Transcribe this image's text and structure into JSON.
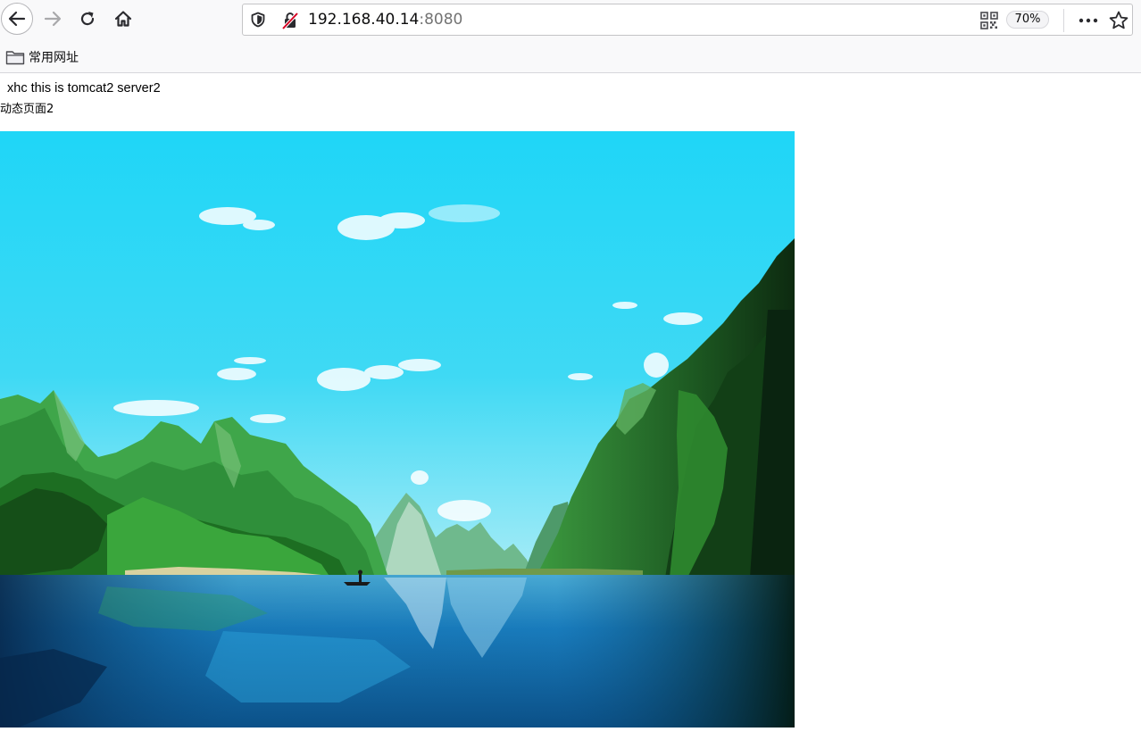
{
  "browser": {
    "url_host": "192.168.40.14",
    "url_port": ":8080",
    "zoom": "70%",
    "icons": {
      "back": "arrow-left-icon",
      "forward": "arrow-right-icon",
      "reload": "reload-icon",
      "home": "home-icon",
      "tracking": "shield-icon",
      "insecure": "insecure-connection-icon",
      "qr": "qr-code-icon",
      "menu": "more-dots-icon",
      "bookmark": "star-icon"
    }
  },
  "bookmarks_bar": {
    "folder_label": "常用网址",
    "folder_icon": "folder-icon"
  },
  "page": {
    "heading": "xhc this is tomcat2 server2",
    "subheading": "动态页面2"
  },
  "colors": {
    "sky": "#1fd4f5",
    "mountains": "#2f9a3a",
    "water": "#1a86c4"
  }
}
